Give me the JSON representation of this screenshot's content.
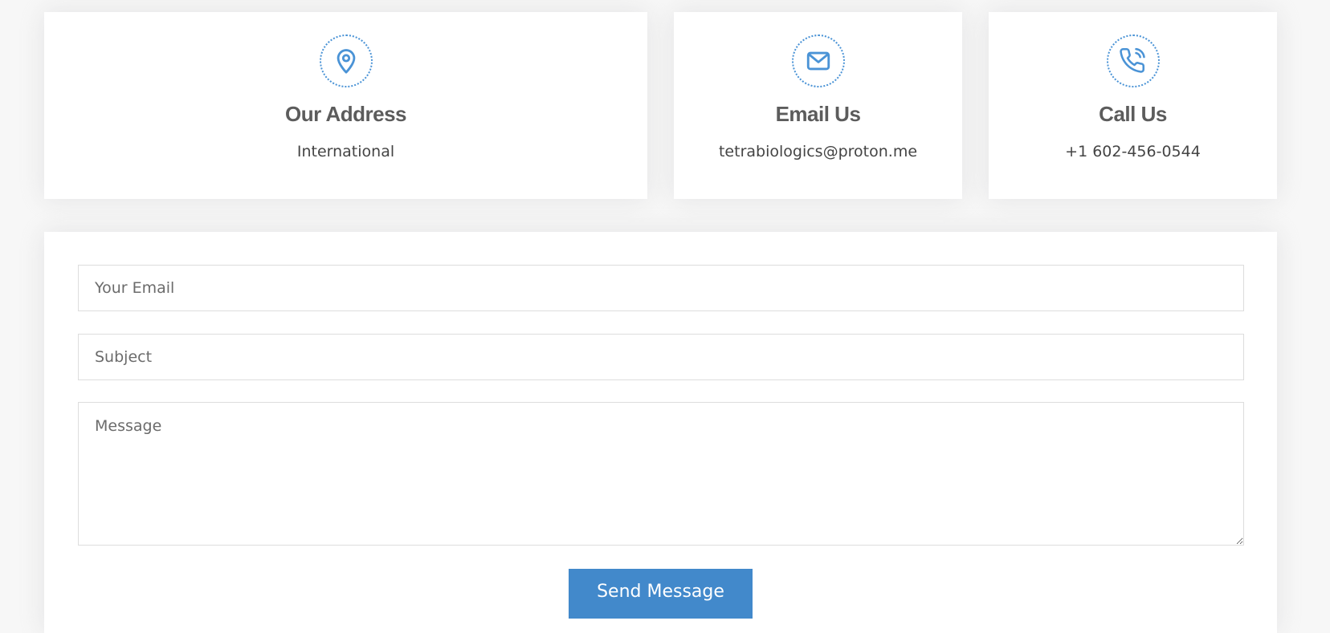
{
  "info_cards": {
    "address": {
      "icon": "map-pin-icon",
      "title": "Our Address",
      "value": "International"
    },
    "email": {
      "icon": "envelope-icon",
      "title": "Email Us",
      "value": "tetrabiologics@proton.me"
    },
    "call": {
      "icon": "phone-icon",
      "title": "Call Us",
      "value": "+1 602-456-0544"
    }
  },
  "form": {
    "email_placeholder": "Your Email",
    "subject_placeholder": "Subject",
    "message_placeholder": "Message",
    "submit_label": "Send Message"
  },
  "colors": {
    "accent": "#4289cb",
    "icon": "#4a93d6",
    "title_text": "#5c5c5c",
    "body_text": "#444444",
    "page_background": "#f7f7f7"
  }
}
